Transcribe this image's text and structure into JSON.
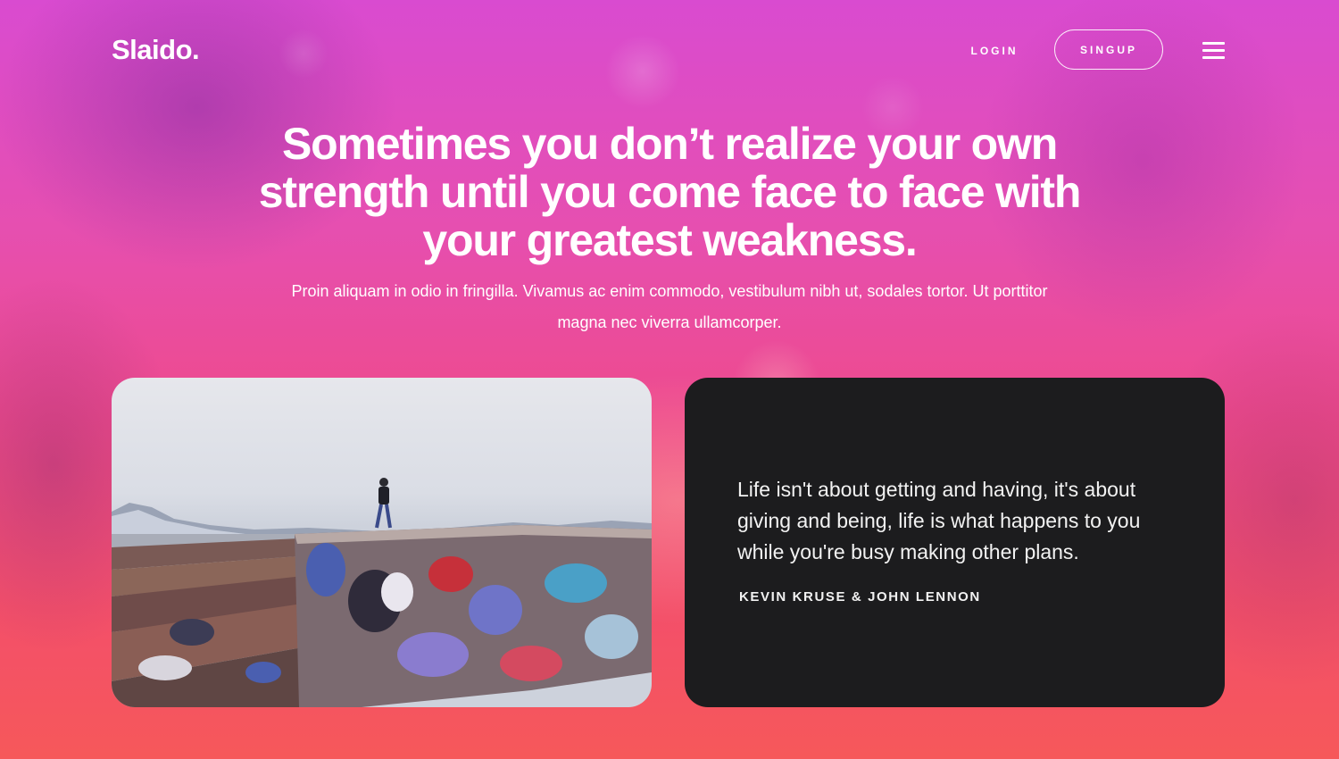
{
  "header": {
    "logo": "Slaido.",
    "login_label": "LOGIN",
    "signup_label": "SINGUP",
    "menu_icon": "hamburger-menu-icon"
  },
  "hero": {
    "headline": "Sometimes you don’t realize your own strength until you come face to face with your greatest weakness.",
    "subtext": "Proin aliquam in odio in fringilla. Vivamus ac enim commodo, vestibulum nibh ut, sodales tortor. Ut porttitor magna nec viverra ullamcorper."
  },
  "quote": {
    "text": "Life isn't about getting and having, it's about giving and being, life is what happens to you while you're busy making other plans.",
    "author": "KEVIN KRUSE & JOHN LENNON"
  },
  "colors": {
    "gradient_top": "#d94bd0",
    "gradient_bottom": "#f6585a",
    "quote_card_bg": "#1c1c1e",
    "text": "#ffffff"
  }
}
